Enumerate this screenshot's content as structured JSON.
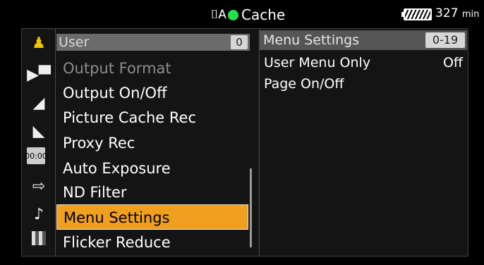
{
  "status": {
    "media_icon": "card-A-icon",
    "media_glyph": "⌷A",
    "record_indicator_color": "#22e34a",
    "mode": "Cache",
    "battery_icon": "battery-icon",
    "remaining": "327",
    "remaining_unit": "min"
  },
  "sidebar": {
    "icons": [
      {
        "name": "user-menu-icon",
        "glyph": "♟"
      },
      {
        "name": "camera-icon",
        "glyph": "▶▀"
      },
      {
        "name": "clapper-icon",
        "glyph": "◢"
      },
      {
        "name": "paint-icon",
        "glyph": "◣"
      },
      {
        "name": "timecode-icon",
        "glyph": "00:00"
      },
      {
        "name": "output-icon",
        "glyph": "⇨"
      },
      {
        "name": "audio-note-icon",
        "glyph": "♪"
      },
      {
        "name": "maintenance-icon",
        "glyph": ""
      }
    ]
  },
  "menu": {
    "header": "User",
    "page": "0",
    "items": [
      {
        "label": "Output Format",
        "state": "dim"
      },
      {
        "label": "Output On/Off",
        "state": "normal"
      },
      {
        "label": "Picture Cache Rec",
        "state": "normal"
      },
      {
        "label": "Proxy Rec",
        "state": "normal"
      },
      {
        "label": "Auto Exposure",
        "state": "normal"
      },
      {
        "label": "ND Filter",
        "state": "normal"
      },
      {
        "label": "Menu Settings",
        "state": "selected"
      },
      {
        "label": "Flicker Reduce",
        "state": "normal"
      }
    ],
    "selected_color": "#f0a020"
  },
  "detail": {
    "title": "Menu Settings",
    "range": "0-19",
    "options": [
      {
        "label": "User Menu Only",
        "value": "Off"
      },
      {
        "label": "Page On/Off",
        "value": ""
      }
    ]
  }
}
